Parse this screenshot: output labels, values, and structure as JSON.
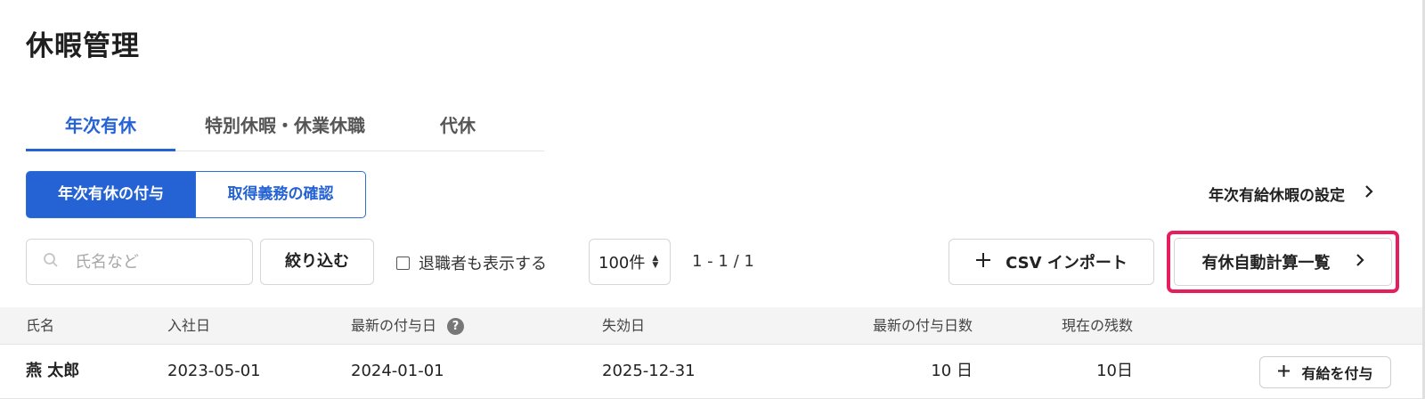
{
  "page": {
    "title": "休暇管理"
  },
  "tabs": [
    {
      "label": "年次有休",
      "active": true
    },
    {
      "label": "特別休暇・休業休職",
      "active": false
    },
    {
      "label": "代休",
      "active": false
    }
  ],
  "segment": {
    "grant_label": "年次有休の付与",
    "confirm_label": "取得義務の確認"
  },
  "settings_link": {
    "label": "年次有給休暇の設定",
    "icon": "chevron-right-icon"
  },
  "toolbar": {
    "search_placeholder": "氏名など",
    "search_icon": "search-icon",
    "filter_label": "絞り込む",
    "show_retired_label": "退職者も表示する",
    "show_retired_checked": false,
    "per_page": "100件",
    "pagination": "1 - 1 / 1",
    "csv_import_label": "CSV インポート",
    "auto_calc_label": "有休自動計算一覧"
  },
  "table": {
    "columns": [
      "氏名",
      "入社日",
      "最新の付与日",
      "失効日",
      "最新の付与日数",
      "現在の残数"
    ],
    "rows": [
      {
        "name": "燕 太郎",
        "hire_date": "2023-05-01",
        "latest_grant_date": "2024-01-01",
        "expiry_date": "2025-12-31",
        "latest_grant_days": "10 日",
        "remaining": "10日",
        "action_label": "有給を付与"
      }
    ]
  },
  "colors": {
    "accent": "#2563d4",
    "highlight": "#e51e5e"
  }
}
